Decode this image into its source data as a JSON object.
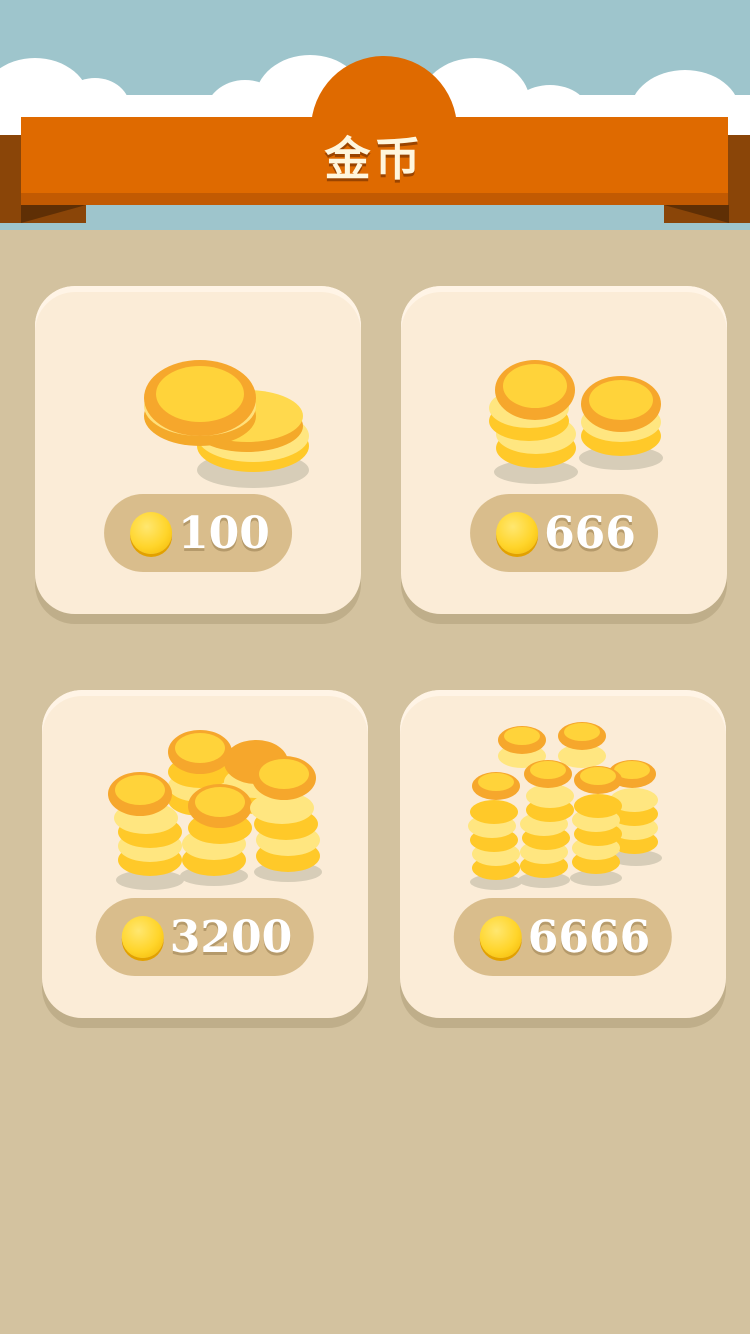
{
  "header": {
    "title": "金币"
  },
  "products": [
    {
      "amount": "100",
      "icon": "coin-stack-small-icon"
    },
    {
      "amount": "666",
      "icon": "coin-stack-medium-icon"
    },
    {
      "amount": "3200",
      "icon": "coin-pile-large-icon"
    },
    {
      "amount": "6666",
      "icon": "coin-pile-huge-icon"
    }
  ],
  "colors": {
    "banner": "#df6a00",
    "sky": "#9ec5cc",
    "background": "#d3c29f",
    "card": "#fbecd7",
    "pill": "#d9bd8c",
    "coin": "#ffd52b"
  }
}
